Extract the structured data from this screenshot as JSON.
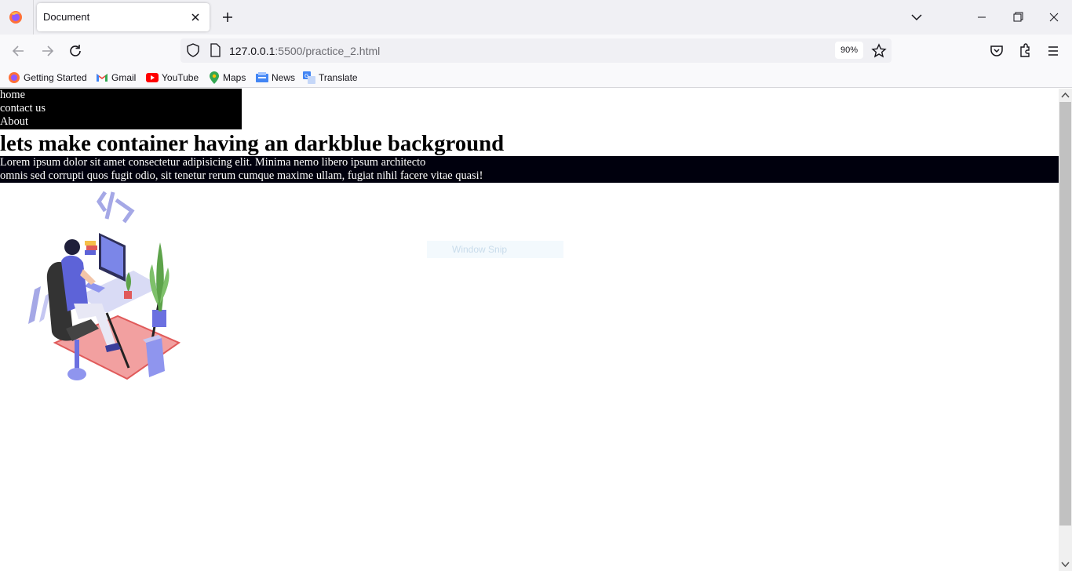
{
  "browser": {
    "tab_title": "Document",
    "url_host": "127.0.0.1",
    "url_rest": ":5500/practice_2.html",
    "zoom": "90%",
    "bookmarks": [
      {
        "label": "Getting Started",
        "icon": "firefox-icon"
      },
      {
        "label": "Gmail",
        "icon": "gmail-icon"
      },
      {
        "label": "YouTube",
        "icon": "youtube-icon"
      },
      {
        "label": "Maps",
        "icon": "maps-icon"
      },
      {
        "label": "News",
        "icon": "news-icon"
      },
      {
        "label": "Translate",
        "icon": "translate-icon"
      }
    ]
  },
  "page": {
    "menu": [
      "home",
      "contact us",
      "About"
    ],
    "heading": "lets make container having an darkblue background",
    "container_lines": [
      "Lorem ipsum dolor sit amet consectetur adipisicing elit. Minima nemo libero ipsum architecto",
      "omnis sed corrupti quos fugit odio, sit tenetur rerum cumque maxime ullam, fugiat nihil facere vitae quasi!"
    ],
    "container_bg": "#00000d",
    "menu_bg": "#000000"
  },
  "overlay": {
    "snip_label": "Window Snip"
  }
}
